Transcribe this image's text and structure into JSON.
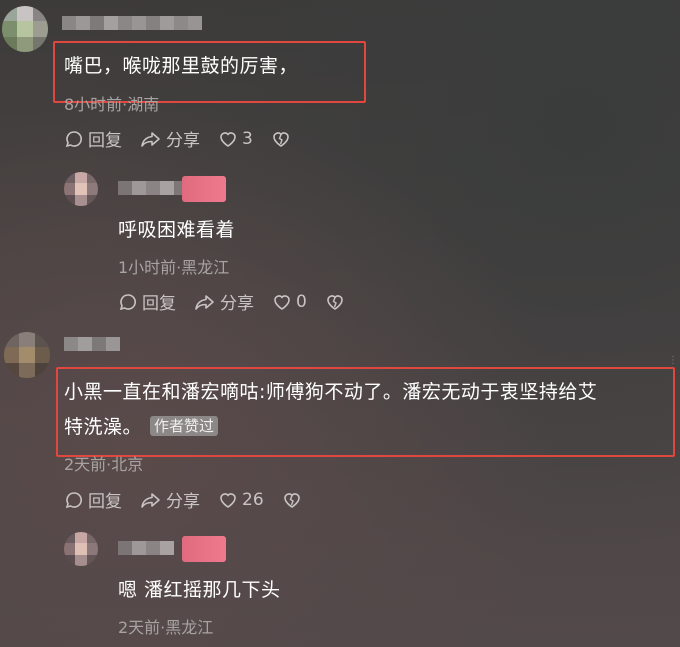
{
  "comments": [
    {
      "text": "嘴巴，喉咙那里鼓的厉害，",
      "meta": "8小时前·湖南",
      "reply_label": "回复",
      "share_label": "分享",
      "likes": "3",
      "replies": [
        {
          "text": "呼吸困难看着",
          "meta": "1小时前·黑龙江",
          "reply_label": "回复",
          "share_label": "分享",
          "likes": "0"
        }
      ]
    },
    {
      "text": "小黑一直在和潘宏嘀咕:师傅狗不动了。潘宏无动于衷坚持给艾",
      "text_line2": "特洗澡。",
      "badge": "作者赞过",
      "meta": "2天前·北京",
      "reply_label": "回复",
      "share_label": "分享",
      "likes": "26",
      "replies": [
        {
          "text": "嗯 潘红摇那几下头",
          "meta": "2天前·黑龙江"
        }
      ]
    }
  ],
  "colors": {
    "highlight": "#e0483f",
    "author_badge_bg": "#8c8888",
    "meta": "#a8a3a3"
  }
}
